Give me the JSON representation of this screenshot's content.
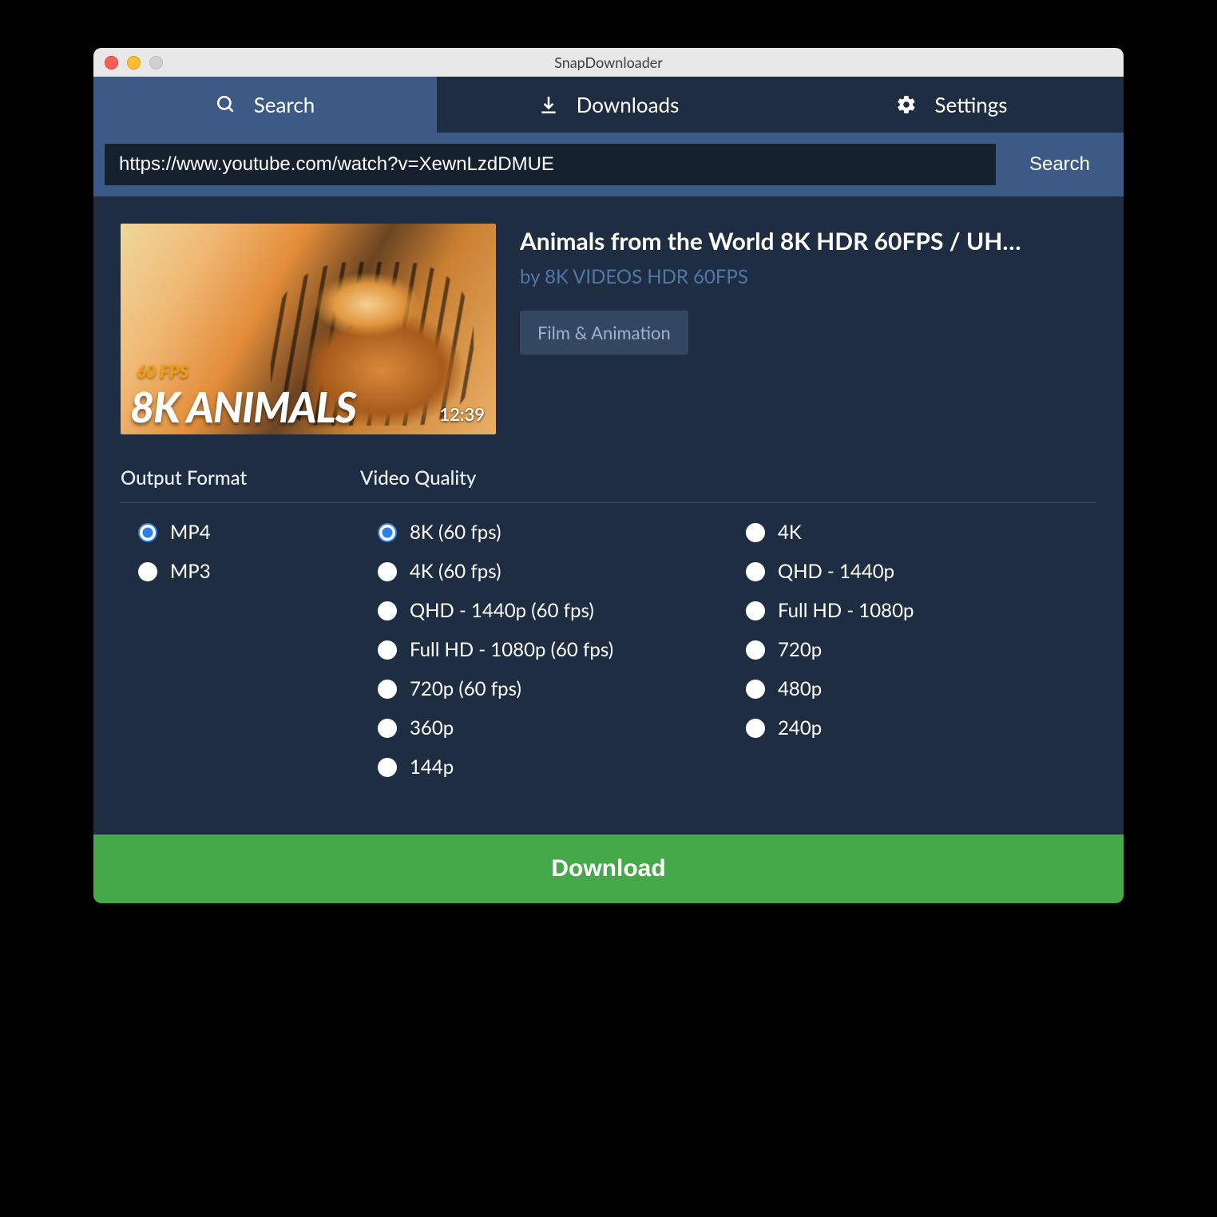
{
  "window": {
    "title": "SnapDownloader"
  },
  "tabs": {
    "search": "Search",
    "downloads": "Downloads",
    "settings": "Settings"
  },
  "search": {
    "url_value": "https://www.youtube.com/watch?v=XewnLzdDMUE",
    "button": "Search"
  },
  "video": {
    "title": "Animals from the World 8K HDR 60FPS / UH…",
    "author_prefix": "by ",
    "author": "8K VIDEOS HDR 60FPS",
    "category": "Film & Animation",
    "duration": "12:39",
    "thumb_fps_label": "60 FPS",
    "thumb_8k_label": "8K ANIMALS"
  },
  "output_format": {
    "heading": "Output Format",
    "options": {
      "mp4": "MP4",
      "mp3": "MP3"
    },
    "selected": "mp4"
  },
  "video_quality": {
    "heading": "Video Quality",
    "col1": {
      "q8k60": "8K (60 fps)",
      "q4k60": "4K (60 fps)",
      "qhd60": "QHD - 1440p (60 fps)",
      "fhd60": "Full HD - 1080p (60 fps)",
      "q72060": "720p (60 fps)",
      "q360": "360p",
      "q144": "144p"
    },
    "col2": {
      "q4k": "4K",
      "qhd": "QHD - 1440p",
      "fhd": "Full HD - 1080p",
      "q720": "720p",
      "q480": "480p",
      "q240": "240p"
    },
    "selected": "q8k60"
  },
  "download_button": "Download"
}
